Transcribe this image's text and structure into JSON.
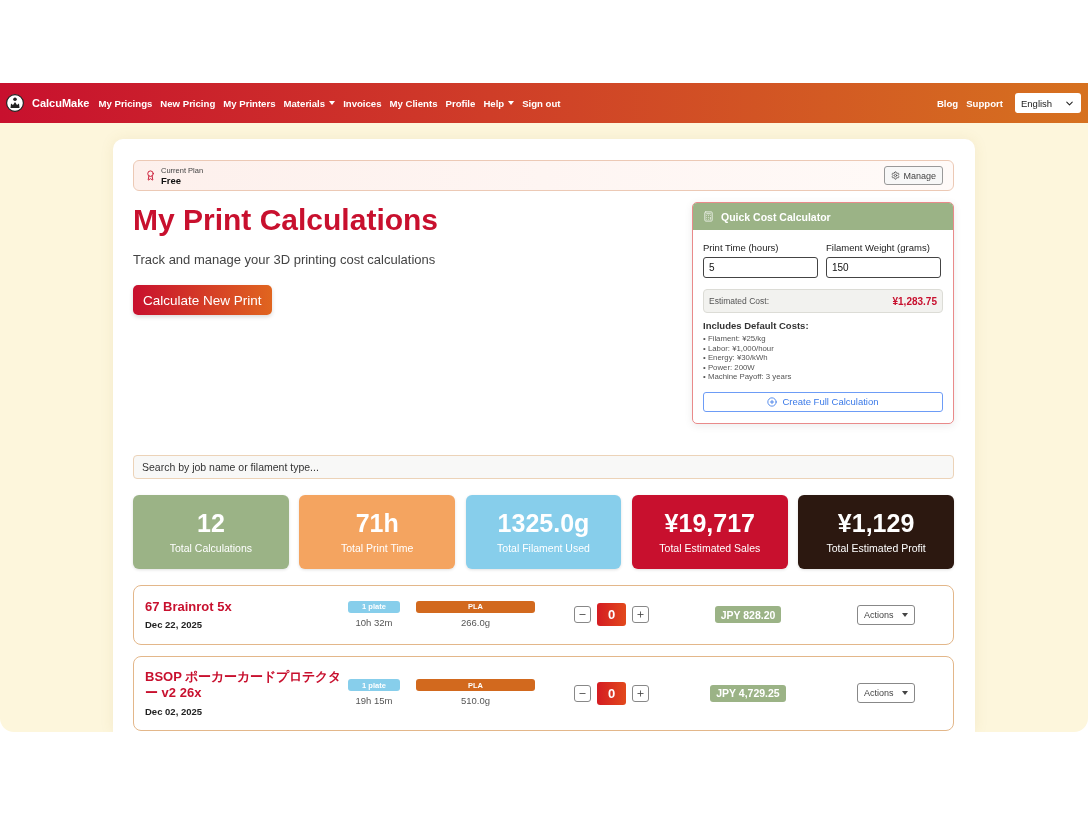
{
  "navbar": {
    "brand": "CalcuMake",
    "links": [
      {
        "label": "My Pricings",
        "dropdown": false
      },
      {
        "label": "New Pricing",
        "dropdown": false
      },
      {
        "label": "My Printers",
        "dropdown": false
      },
      {
        "label": "Materials",
        "dropdown": true
      },
      {
        "label": "Invoices",
        "dropdown": false
      },
      {
        "label": "My Clients",
        "dropdown": false
      },
      {
        "label": "Profile",
        "dropdown": false
      },
      {
        "label": "Help",
        "dropdown": true
      },
      {
        "label": "Sign out",
        "dropdown": false
      }
    ],
    "right_links": [
      "Blog",
      "Support"
    ],
    "language": "English"
  },
  "plan": {
    "label": "Current Plan",
    "name": "Free",
    "button": "Manage"
  },
  "header": {
    "title": "My Print Calculations",
    "subtitle": "Track and manage your 3D printing cost calculations",
    "button": "Calculate New Print"
  },
  "quick_calculator": {
    "title": "Quick Cost Calculator",
    "fields": [
      {
        "label": "Print Time (hours)",
        "value": "5"
      },
      {
        "label": "Filament Weight (grams)",
        "value": "150"
      }
    ],
    "estimate_label": "Estimated Cost:",
    "estimate_value": "¥1,283.75",
    "defaults_title": "Includes Default Costs:",
    "defaults": [
      "• Filament: ¥25/kg",
      "• Labor: ¥1,000/hour",
      "• Energy: ¥30/kWh",
      "• Power: 200W",
      "• Machine Payoff: 3 years"
    ],
    "button": "Create Full Calculation"
  },
  "search": {
    "placeholder": "Search by job name or filament type..."
  },
  "stats": [
    {
      "value": "12",
      "label": "Total Calculations",
      "color": "#9bb386"
    },
    {
      "value": "71h",
      "label": "Total Print Time",
      "color": "#f4a460"
    },
    {
      "value": "1325.0g",
      "label": "Total Filament Used",
      "color": "#87ceeb"
    },
    {
      "value": "¥19,717",
      "label": "Total Estimated Sales",
      "color": "#c8102e"
    },
    {
      "value": "¥1,129",
      "label": "Total Estimated Profit",
      "color": "#2c1810"
    }
  ],
  "calculations": [
    {
      "name": "67 Brainrot 5x",
      "date": "Dec 22, 2025",
      "plates": "1 plate",
      "time": "10h 32m",
      "material": "PLA",
      "weight": "266.0g",
      "quantity": "0",
      "price": "JPY 828.20",
      "actions": "Actions"
    },
    {
      "name": "BSOP ポーカーカードプロテクター v2 26x",
      "date": "Dec 02, 2025",
      "plates": "1 plate",
      "time": "19h 15m",
      "material": "PLA",
      "weight": "510.0g",
      "quantity": "0",
      "price": "JPY 4,729.25",
      "actions": "Actions"
    }
  ]
}
